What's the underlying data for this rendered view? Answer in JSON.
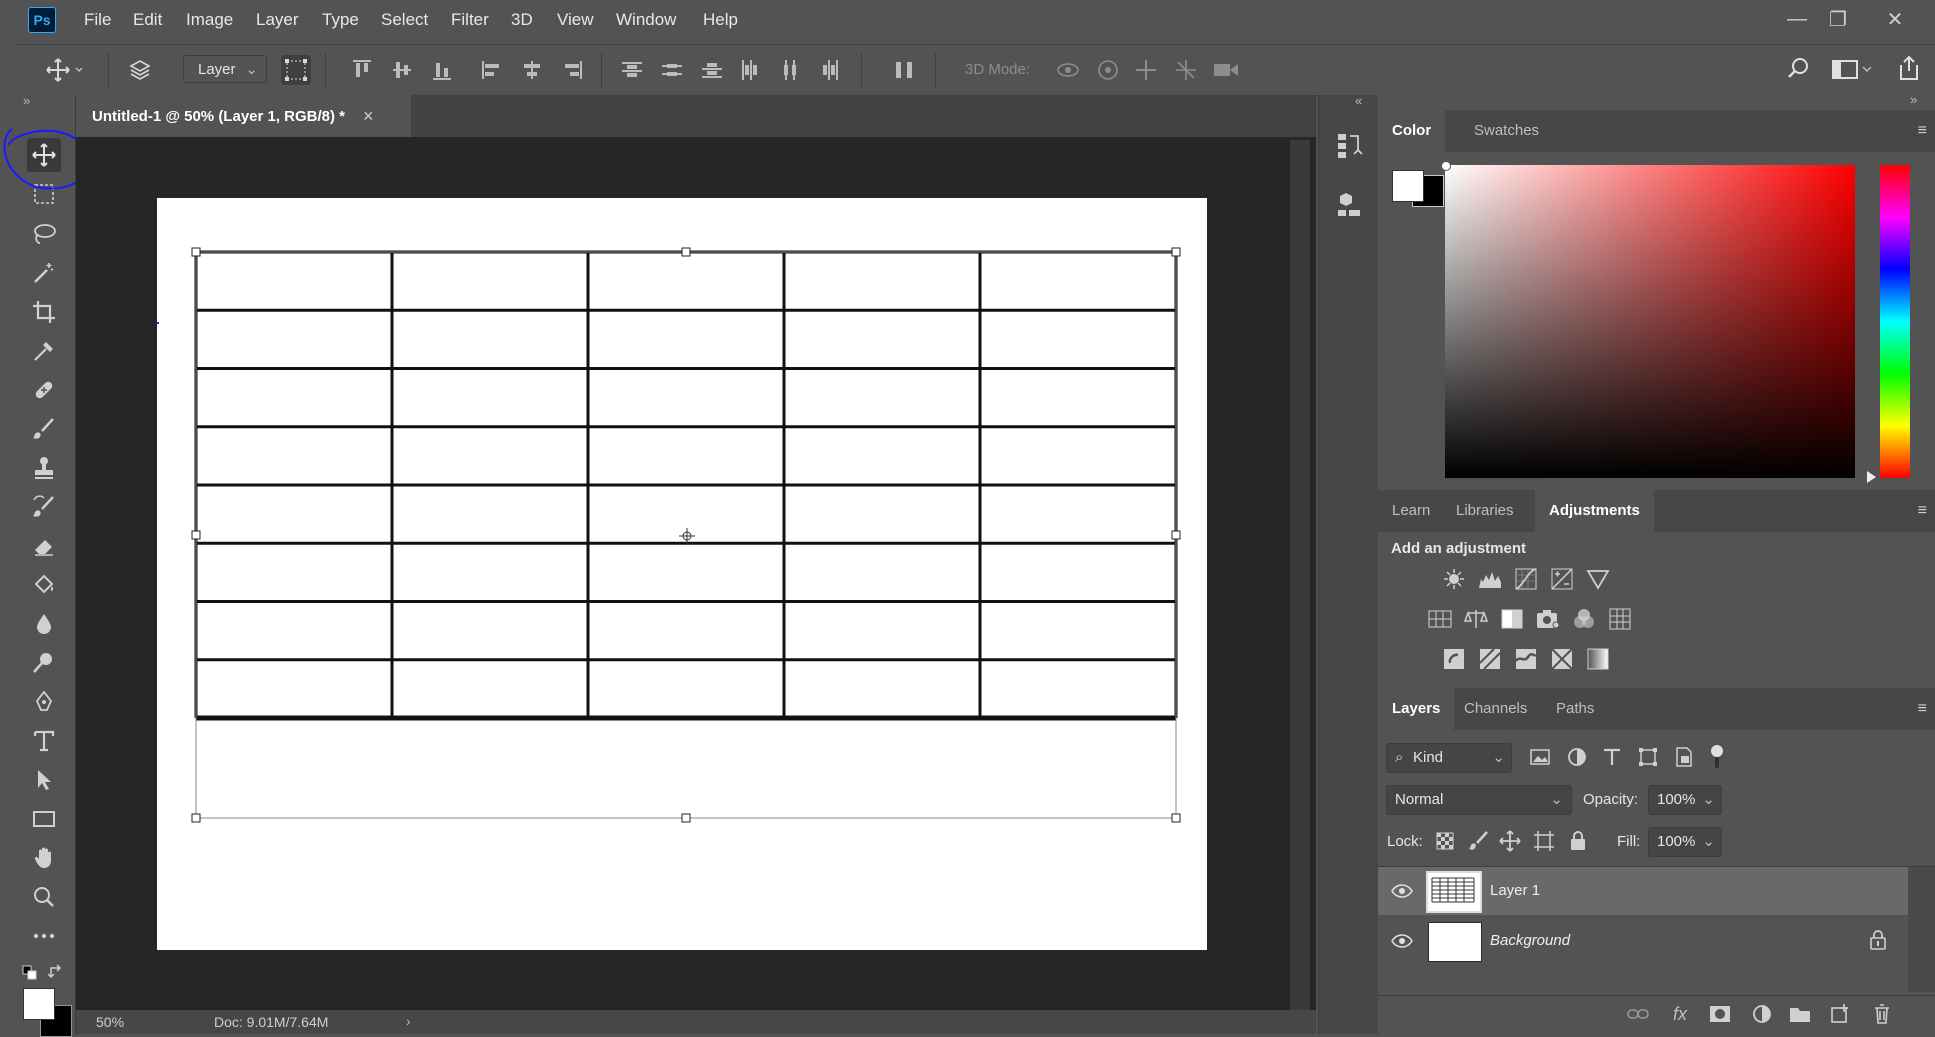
{
  "app": {
    "logo": "Ps"
  },
  "menu": [
    "File",
    "Edit",
    "Image",
    "Layer",
    "Type",
    "Select",
    "Filter",
    "3D",
    "View",
    "Window",
    "Help"
  ],
  "window_controls": {
    "minimize": "—",
    "restore": "❐",
    "close": "✕"
  },
  "options_bar": {
    "auto_select_value": "Layer",
    "mode_3d_label": "3D Mode:"
  },
  "document": {
    "tab_title": "Untitled-1 @ 50% (Layer 1, RGB/8) *",
    "tab_close": "×",
    "zoom": "50%",
    "doc_info": "Doc: 9.01M/7.64M",
    "table_rows": 8,
    "table_cols": 5
  },
  "color_panel": {
    "tabs": [
      "Color",
      "Swatches"
    ],
    "active": "Color",
    "foreground": "#ffffff",
    "background": "#000000"
  },
  "adjustments_panel": {
    "tabs": [
      "Learn",
      "Libraries",
      "Adjustments"
    ],
    "active": "Adjustments",
    "heading": "Add an adjustment"
  },
  "layers_panel": {
    "tabs": [
      "Layers",
      "Channels",
      "Paths"
    ],
    "active": "Layers",
    "filter_kind": "Kind",
    "blend_mode": "Normal",
    "opacity_label": "Opacity:",
    "opacity_value": "100%",
    "lock_label": "Lock:",
    "fill_label": "Fill:",
    "fill_value": "100%",
    "layers": [
      {
        "name": "Layer 1",
        "selected": true
      },
      {
        "name": "Background",
        "selected": false,
        "locked": true
      }
    ]
  },
  "colors": {
    "accent": "#31a8ff",
    "annotation": "#1a1aff",
    "panel_bg": "#535353",
    "canvas_bg": "#262626"
  }
}
